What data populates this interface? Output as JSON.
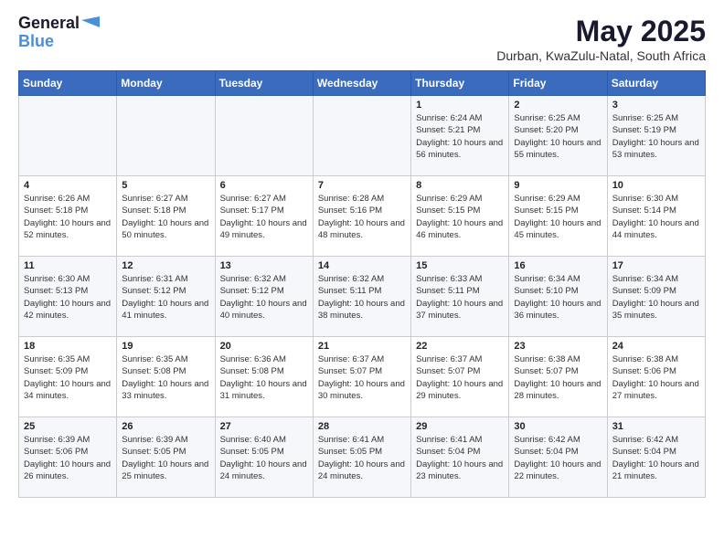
{
  "logo": {
    "line1": "General",
    "line2": "Blue"
  },
  "title": "May 2025",
  "location": "Durban, KwaZulu-Natal, South Africa",
  "days_of_week": [
    "Sunday",
    "Monday",
    "Tuesday",
    "Wednesday",
    "Thursday",
    "Friday",
    "Saturday"
  ],
  "weeks": [
    [
      {
        "day": "",
        "content": ""
      },
      {
        "day": "",
        "content": ""
      },
      {
        "day": "",
        "content": ""
      },
      {
        "day": "",
        "content": ""
      },
      {
        "day": "1",
        "content": "Sunrise: 6:24 AM\nSunset: 5:21 PM\nDaylight: 10 hours\nand 56 minutes."
      },
      {
        "day": "2",
        "content": "Sunrise: 6:25 AM\nSunset: 5:20 PM\nDaylight: 10 hours\nand 55 minutes."
      },
      {
        "day": "3",
        "content": "Sunrise: 6:25 AM\nSunset: 5:19 PM\nDaylight: 10 hours\nand 53 minutes."
      }
    ],
    [
      {
        "day": "4",
        "content": "Sunrise: 6:26 AM\nSunset: 5:18 PM\nDaylight: 10 hours\nand 52 minutes."
      },
      {
        "day": "5",
        "content": "Sunrise: 6:27 AM\nSunset: 5:18 PM\nDaylight: 10 hours\nand 50 minutes."
      },
      {
        "day": "6",
        "content": "Sunrise: 6:27 AM\nSunset: 5:17 PM\nDaylight: 10 hours\nand 49 minutes."
      },
      {
        "day": "7",
        "content": "Sunrise: 6:28 AM\nSunset: 5:16 PM\nDaylight: 10 hours\nand 48 minutes."
      },
      {
        "day": "8",
        "content": "Sunrise: 6:29 AM\nSunset: 5:15 PM\nDaylight: 10 hours\nand 46 minutes."
      },
      {
        "day": "9",
        "content": "Sunrise: 6:29 AM\nSunset: 5:15 PM\nDaylight: 10 hours\nand 45 minutes."
      },
      {
        "day": "10",
        "content": "Sunrise: 6:30 AM\nSunset: 5:14 PM\nDaylight: 10 hours\nand 44 minutes."
      }
    ],
    [
      {
        "day": "11",
        "content": "Sunrise: 6:30 AM\nSunset: 5:13 PM\nDaylight: 10 hours\nand 42 minutes."
      },
      {
        "day": "12",
        "content": "Sunrise: 6:31 AM\nSunset: 5:12 PM\nDaylight: 10 hours\nand 41 minutes."
      },
      {
        "day": "13",
        "content": "Sunrise: 6:32 AM\nSunset: 5:12 PM\nDaylight: 10 hours\nand 40 minutes."
      },
      {
        "day": "14",
        "content": "Sunrise: 6:32 AM\nSunset: 5:11 PM\nDaylight: 10 hours\nand 38 minutes."
      },
      {
        "day": "15",
        "content": "Sunrise: 6:33 AM\nSunset: 5:11 PM\nDaylight: 10 hours\nand 37 minutes."
      },
      {
        "day": "16",
        "content": "Sunrise: 6:34 AM\nSunset: 5:10 PM\nDaylight: 10 hours\nand 36 minutes."
      },
      {
        "day": "17",
        "content": "Sunrise: 6:34 AM\nSunset: 5:09 PM\nDaylight: 10 hours\nand 35 minutes."
      }
    ],
    [
      {
        "day": "18",
        "content": "Sunrise: 6:35 AM\nSunset: 5:09 PM\nDaylight: 10 hours\nand 34 minutes."
      },
      {
        "day": "19",
        "content": "Sunrise: 6:35 AM\nSunset: 5:08 PM\nDaylight: 10 hours\nand 33 minutes."
      },
      {
        "day": "20",
        "content": "Sunrise: 6:36 AM\nSunset: 5:08 PM\nDaylight: 10 hours\nand 31 minutes."
      },
      {
        "day": "21",
        "content": "Sunrise: 6:37 AM\nSunset: 5:07 PM\nDaylight: 10 hours\nand 30 minutes."
      },
      {
        "day": "22",
        "content": "Sunrise: 6:37 AM\nSunset: 5:07 PM\nDaylight: 10 hours\nand 29 minutes."
      },
      {
        "day": "23",
        "content": "Sunrise: 6:38 AM\nSunset: 5:07 PM\nDaylight: 10 hours\nand 28 minutes."
      },
      {
        "day": "24",
        "content": "Sunrise: 6:38 AM\nSunset: 5:06 PM\nDaylight: 10 hours\nand 27 minutes."
      }
    ],
    [
      {
        "day": "25",
        "content": "Sunrise: 6:39 AM\nSunset: 5:06 PM\nDaylight: 10 hours\nand 26 minutes."
      },
      {
        "day": "26",
        "content": "Sunrise: 6:39 AM\nSunset: 5:05 PM\nDaylight: 10 hours\nand 25 minutes."
      },
      {
        "day": "27",
        "content": "Sunrise: 6:40 AM\nSunset: 5:05 PM\nDaylight: 10 hours\nand 24 minutes."
      },
      {
        "day": "28",
        "content": "Sunrise: 6:41 AM\nSunset: 5:05 PM\nDaylight: 10 hours\nand 24 minutes."
      },
      {
        "day": "29",
        "content": "Sunrise: 6:41 AM\nSunset: 5:04 PM\nDaylight: 10 hours\nand 23 minutes."
      },
      {
        "day": "30",
        "content": "Sunrise: 6:42 AM\nSunset: 5:04 PM\nDaylight: 10 hours\nand 22 minutes."
      },
      {
        "day": "31",
        "content": "Sunrise: 6:42 AM\nSunset: 5:04 PM\nDaylight: 10 hours\nand 21 minutes."
      }
    ]
  ]
}
